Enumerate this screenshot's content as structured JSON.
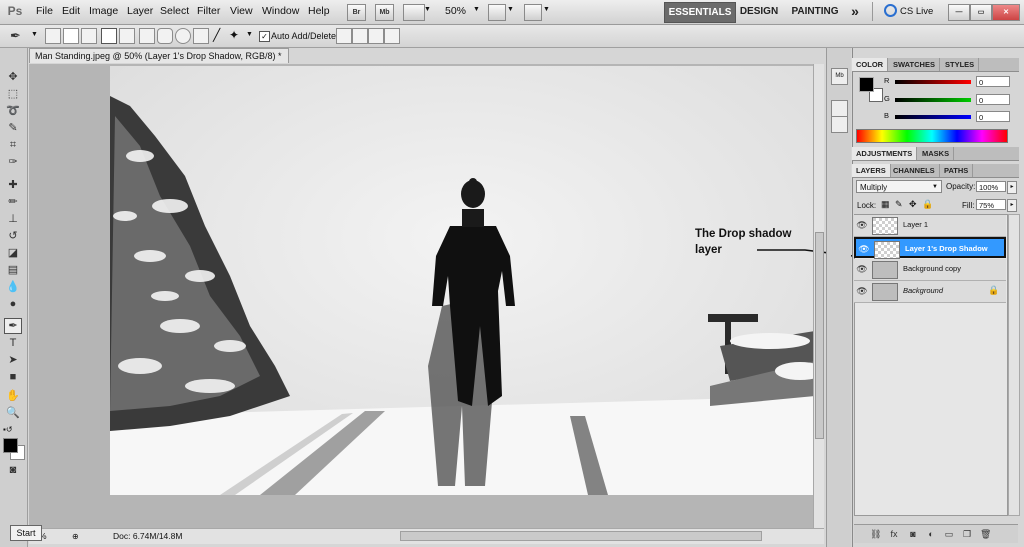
{
  "app": {
    "logo": "Ps"
  },
  "menu": [
    "File",
    "Edit",
    "Image",
    "Layer",
    "Select",
    "Filter",
    "View",
    "Window",
    "Help"
  ],
  "quick_buttons": {
    "bridge": "Br",
    "mini_bridge": "Mb"
  },
  "zoom": "50%",
  "workspaces": [
    "ESSENTIALS",
    "DESIGN",
    "PAINTING"
  ],
  "workspace_more": "»",
  "cs_live": "CS Live",
  "options_bar": {
    "auto_add_delete_label": "Auto Add/Delete",
    "auto_add_delete_checked": true
  },
  "document": {
    "tab_title": "Man Standing.jpeg @ 50% (Layer 1's Drop Shadow, RGB/8) *",
    "close": "✕"
  },
  "status": {
    "zoom": "%",
    "doc_size": "Doc: 6.74M/14.8M",
    "start_tooltip": "Start"
  },
  "color_panel": {
    "tabs": [
      "COLOR",
      "SWATCHES",
      "STYLES"
    ],
    "channels": [
      {
        "label": "R",
        "value": "0",
        "color": "#d21010"
      },
      {
        "label": "G",
        "value": "0",
        "color": "#10b010"
      },
      {
        "label": "B",
        "value": "0",
        "color": "#1020d0"
      }
    ]
  },
  "adjust_panel": {
    "tabs": [
      "ADJUSTMENTS",
      "MASKS"
    ]
  },
  "layers_panel": {
    "tabs": [
      "LAYERS",
      "CHANNELS",
      "PATHS"
    ],
    "blend_mode": "Multiply",
    "opacity_label": "Opacity:",
    "opacity": "100%",
    "lock_label": "Lock:",
    "fill_label": "Fill:",
    "fill": "75%",
    "layers": [
      {
        "name": "Layer 1",
        "selected": false,
        "italic": false
      },
      {
        "name": "Layer 1's Drop Shadow",
        "selected": true,
        "italic": false
      },
      {
        "name": "Background copy",
        "selected": false,
        "italic": false
      },
      {
        "name": "Background",
        "selected": false,
        "italic": true
      }
    ]
  },
  "annotation": {
    "text_line1": "The Drop shadow",
    "text_line2": "layer"
  },
  "colors": {
    "selection": "#3399ff",
    "chrome": "#d6d6d6",
    "workspace_active": "#6b6b6b"
  }
}
